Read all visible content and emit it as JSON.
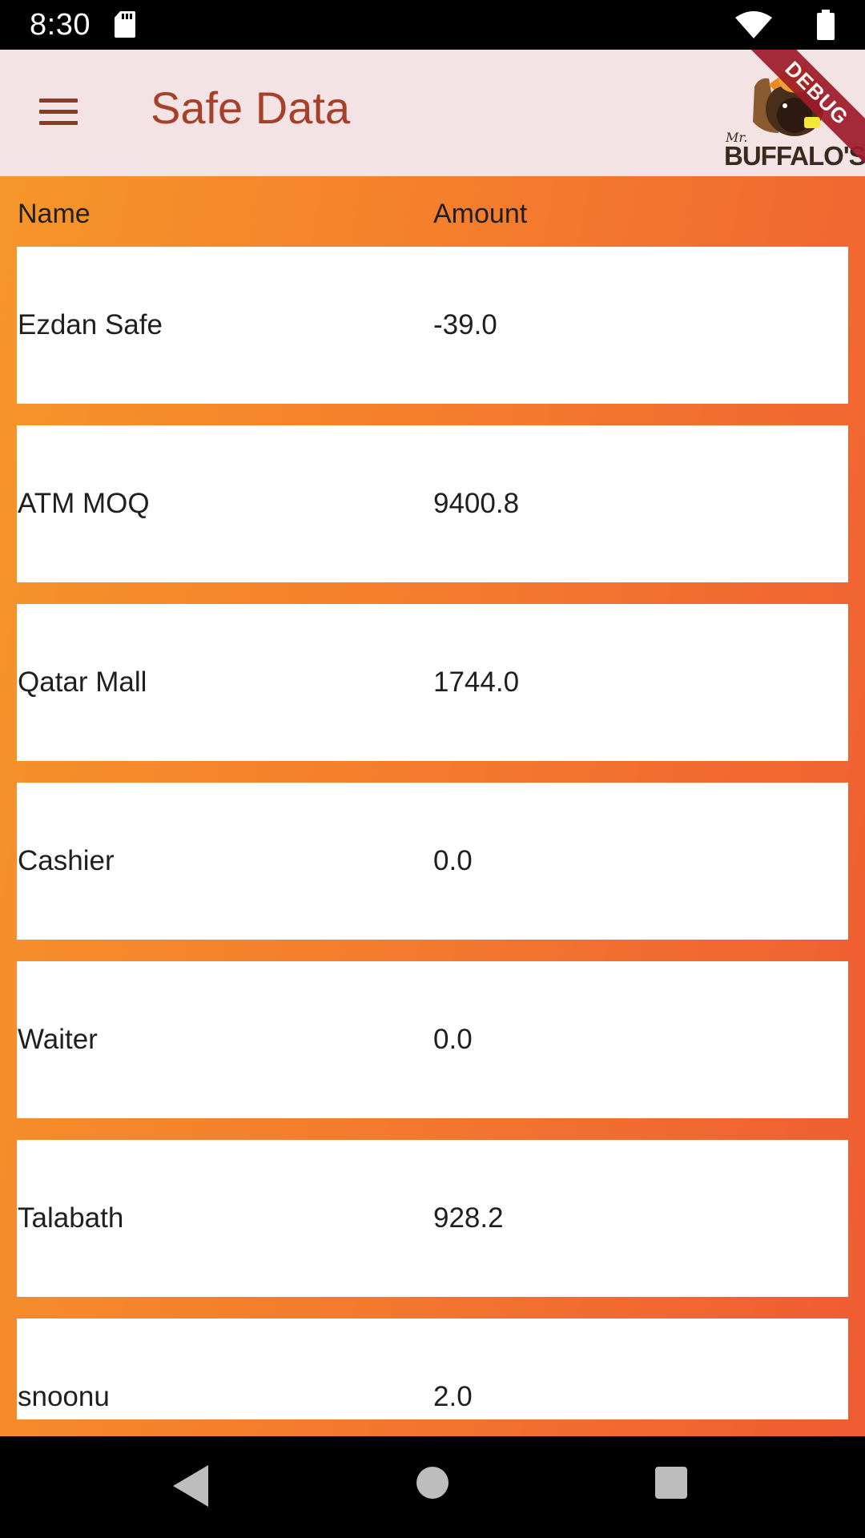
{
  "status_bar": {
    "time": "8:30"
  },
  "app_bar": {
    "title": "Safe Data",
    "menu_icon": "menu-icon",
    "logo_text": "BUFFALO'S",
    "logo_prefix": "Mr."
  },
  "debug_banner": "DEBUG",
  "table": {
    "columns": [
      "Name",
      "Amount"
    ],
    "rows": [
      {
        "name": "Ezdan Safe",
        "amount": "-39.0"
      },
      {
        "name": "ATM MOQ",
        "amount": "9400.8"
      },
      {
        "name": "Qatar Mall",
        "amount": "1744.0"
      },
      {
        "name": "Cashier",
        "amount": "0.0"
      },
      {
        "name": "Waiter",
        "amount": "0.0"
      },
      {
        "name": "Talabath",
        "amount": "928.2"
      },
      {
        "name": "snoonu",
        "amount": "2.0"
      }
    ]
  },
  "colors": {
    "app_bar_bg": "#f3e3e4",
    "title": "#a5402a",
    "gradient_start": "#f6962a",
    "gradient_end": "#ef5b33"
  },
  "nav_bar": {
    "back_icon": "back-triangle-icon",
    "home_icon": "home-circle-icon",
    "recent_icon": "recent-square-icon"
  }
}
